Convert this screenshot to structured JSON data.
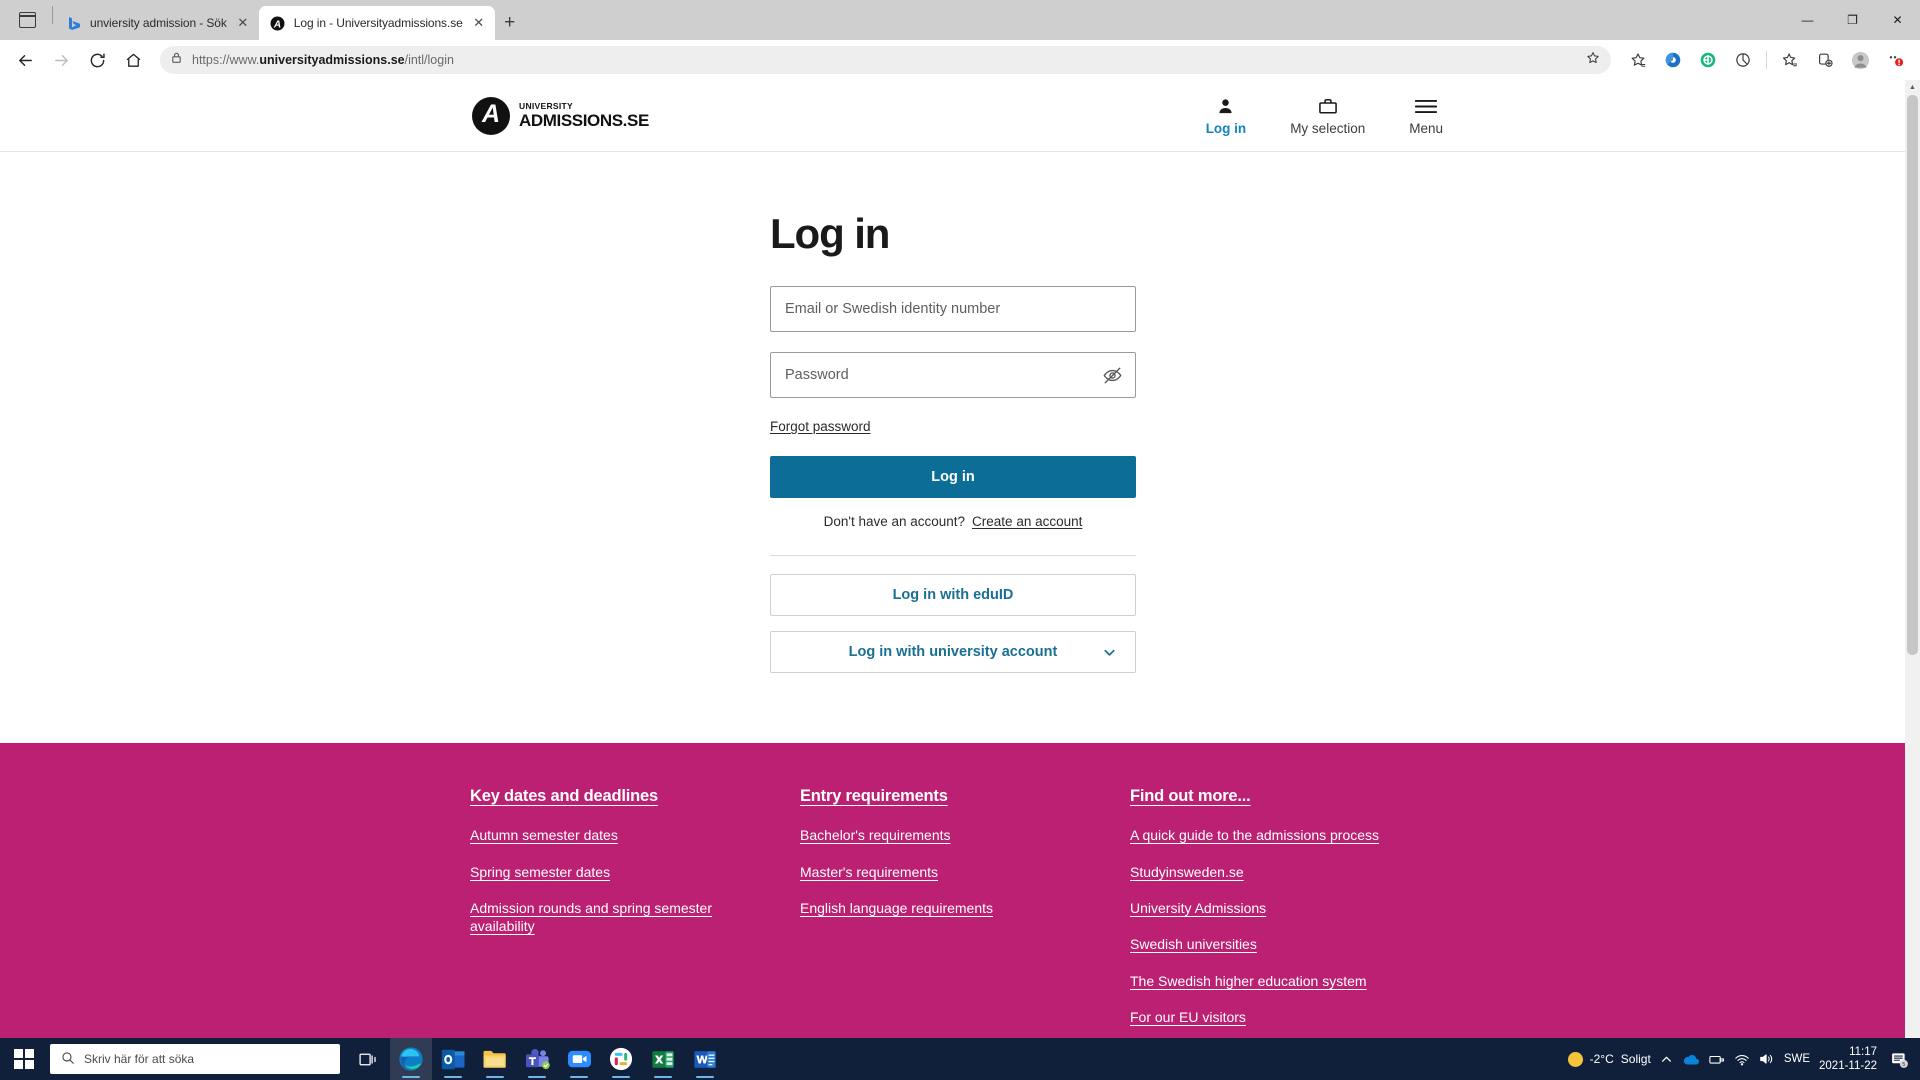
{
  "browser": {
    "tabs": [
      {
        "title": "unviersity admission - Sök",
        "favicon": "bing-icon",
        "active": false
      },
      {
        "title": "Log in - Universityadmissions.se",
        "favicon": "universityadmissions-icon",
        "active": true
      }
    ],
    "new_tab_label": "+",
    "window_controls": {
      "minimize": "—",
      "maximize": "❐",
      "close": "✕"
    },
    "address": {
      "url_prefix": "https://www.",
      "url_domain": "universityadmissions.se",
      "url_path": "/intl/login",
      "full_url": "https://www.universityadmissions.se/intl/login"
    },
    "toolbar_icons": [
      "back-icon",
      "forward-icon",
      "reload-icon",
      "home-icon",
      "lock-icon",
      "favorite-star-icon",
      "collections-icon",
      "extensions-icon",
      "browser-essentials-icon",
      "split-screen-icon",
      "favorites-bar-icon",
      "add-collection-icon",
      "profile-icon",
      "settings-more-icon"
    ]
  },
  "site": {
    "logo": {
      "mark_letter": "A",
      "line1": "UNIVERSITY",
      "line2": "ADMISSIONS.SE"
    },
    "nav": [
      {
        "label": "Log in",
        "icon": "person-icon",
        "active": true
      },
      {
        "label": "My selection",
        "icon": "briefcase-icon",
        "active": false
      },
      {
        "label": "Menu",
        "icon": "hamburger-menu-icon",
        "active": false
      }
    ]
  },
  "login": {
    "title": "Log in",
    "email_placeholder": "Email or Swedish identity number",
    "email_value": "",
    "password_placeholder": "Password",
    "password_value": "",
    "toggle_password_icon": "eye-slash-icon",
    "forgot_password": "Forgot password",
    "submit_label": "Log in",
    "no_account_text": "Don't have an account?",
    "create_account_label": "Create an account",
    "eduid_label": "Log in with eduID",
    "university_account_label": "Log in with university account",
    "university_account_chevron": "chevron-down-icon",
    "primary_color": "#0c6e96"
  },
  "footer": {
    "background_color": "#bc2073",
    "columns": [
      {
        "heading": "Key dates and deadlines",
        "links": [
          "Autumn semester dates",
          "Spring semester dates",
          "Admission rounds and spring semester availability"
        ]
      },
      {
        "heading": "Entry requirements",
        "links": [
          "Bachelor's requirements",
          "Master's requirements",
          "English language requirements"
        ]
      },
      {
        "heading": "Find out more...",
        "links": [
          "A quick guide to the admissions process",
          "Studyinsweden.se",
          "University Admissions",
          "Swedish universities",
          "The Swedish higher education system",
          "For our EU visitors"
        ]
      }
    ]
  },
  "taskbar": {
    "start_icon": "windows-start-icon",
    "search_placeholder": "Skriv här för att söka",
    "search_icon": "search-icon",
    "apps": [
      {
        "name": "task-view-icon"
      },
      {
        "name": "microsoft-edge-icon"
      },
      {
        "name": "outlook-icon"
      },
      {
        "name": "file-explorer-icon"
      },
      {
        "name": "microsoft-teams-icon"
      },
      {
        "name": "zoom-icon"
      },
      {
        "name": "slack-icon"
      },
      {
        "name": "excel-icon"
      },
      {
        "name": "word-icon"
      }
    ],
    "tray": {
      "weather_temp": "-2°C",
      "weather_desc": "Soligt",
      "chevron": "show-hidden-icons-icon",
      "icons": [
        "onedrive-icon",
        "removable-media-icon",
        "network-icon",
        "volume-icon"
      ],
      "language": "SWE",
      "time": "11:17",
      "date": "2021-11-22",
      "action_center": "notifications-icon"
    }
  }
}
